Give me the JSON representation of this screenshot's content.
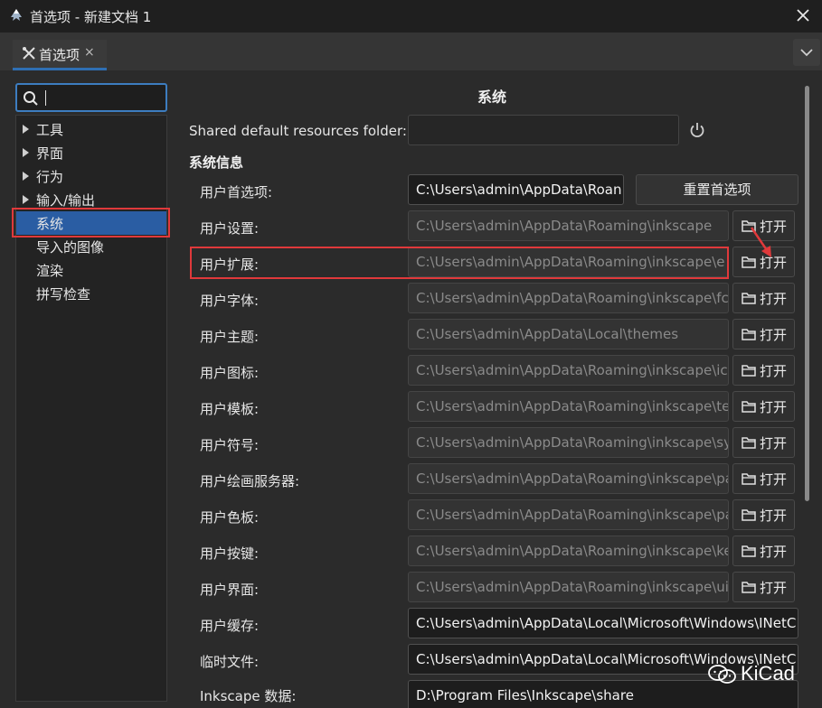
{
  "window": {
    "title": "首选项 - 新建文档 1"
  },
  "tabs": [
    {
      "label": "首选项",
      "close": "×"
    }
  ],
  "sidebar": {
    "search_value": "",
    "items": [
      {
        "label": "工具",
        "expandable": true
      },
      {
        "label": "界面",
        "expandable": true
      },
      {
        "label": "行为",
        "expandable": true
      },
      {
        "label": "输入/输出",
        "expandable": true
      },
      {
        "label": "系统",
        "expandable": false,
        "selected": true
      },
      {
        "label": "导入的图像",
        "expandable": false
      },
      {
        "label": "渲染",
        "expandable": false
      },
      {
        "label": "拼写检查",
        "expandable": false
      }
    ]
  },
  "main": {
    "heading": "系统",
    "shared_label": "Shared default resources folder:",
    "shared_value": "",
    "group_label": "系统信息",
    "reset_label": "重置首选项",
    "open_label": "打开",
    "rows": [
      {
        "label": "用户首选项:",
        "value": "C:\\Users\\admin\\AppData\\Roan",
        "state": "active"
      },
      {
        "label": "用户设置:",
        "value": "C:\\Users\\admin\\AppData\\Roaming\\inkscape",
        "state": "disabled"
      },
      {
        "label": "用户扩展:",
        "value": "C:\\Users\\admin\\AppData\\Roaming\\inkscape\\e",
        "state": "disabled"
      },
      {
        "label": "用户字体:",
        "value": "C:\\Users\\admin\\AppData\\Roaming\\inkscape\\fc",
        "state": "disabled"
      },
      {
        "label": "用户主题:",
        "value": "C:\\Users\\admin\\AppData\\Local\\themes",
        "state": "disabled"
      },
      {
        "label": "用户图标:",
        "value": "C:\\Users\\admin\\AppData\\Roaming\\inkscape\\ic",
        "state": "disabled"
      },
      {
        "label": "用户模板:",
        "value": "C:\\Users\\admin\\AppData\\Roaming\\inkscape\\te",
        "state": "disabled"
      },
      {
        "label": "用户符号:",
        "value": "C:\\Users\\admin\\AppData\\Roaming\\inkscape\\sy",
        "state": "disabled"
      },
      {
        "label": "用户绘画服务器:",
        "value": "C:\\Users\\admin\\AppData\\Roaming\\inkscape\\pa",
        "state": "disabled"
      },
      {
        "label": "用户色板:",
        "value": "C:\\Users\\admin\\AppData\\Roaming\\inkscape\\pa",
        "state": "disabled"
      },
      {
        "label": "用户按键:",
        "value": "C:\\Users\\admin\\AppData\\Roaming\\inkscape\\ke",
        "state": "disabled"
      },
      {
        "label": "用户界面:",
        "value": "C:\\Users\\admin\\AppData\\Roaming\\inkscape\\ui",
        "state": "disabled"
      },
      {
        "label": "用户缓存:",
        "value": "C:\\Users\\admin\\AppData\\Local\\Microsoft\\Windows\\INetC",
        "state": "active"
      },
      {
        "label": "临时文件:",
        "value": "C:\\Users\\admin\\AppData\\Local\\Microsoft\\Windows\\INetC",
        "state": "active"
      },
      {
        "label": "Inkscape 数据:",
        "value": "D:\\Program Files\\Inkscape\\share",
        "state": "active"
      }
    ]
  },
  "watermark": {
    "text": "KiCad"
  },
  "colors": {
    "accent": "#2a5da3",
    "highlight": "#e0393b",
    "background": "#2b2b2b"
  }
}
